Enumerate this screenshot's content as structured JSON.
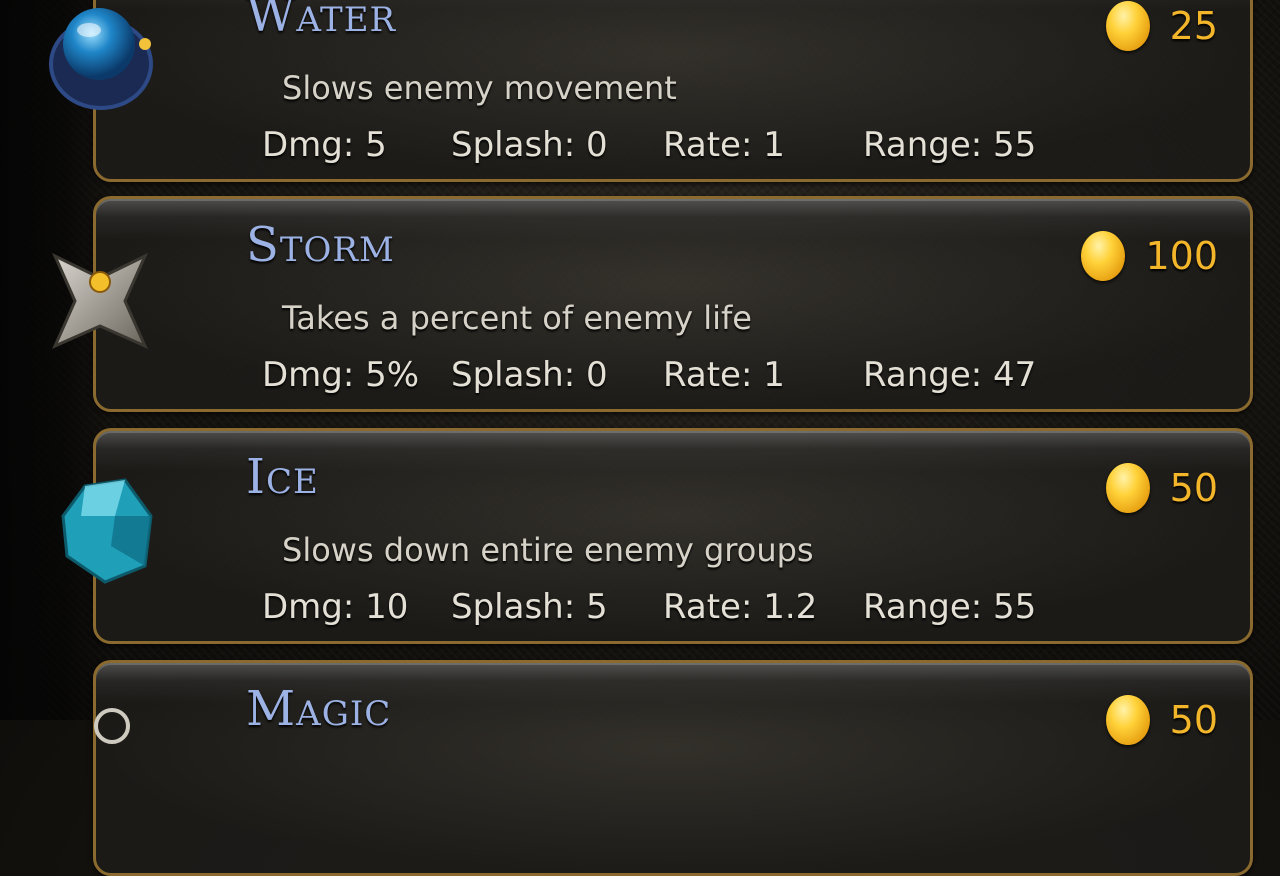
{
  "towers": [
    {
      "name": "Water",
      "description": "Slows enemy movement",
      "dmg": "Dmg: 5",
      "splash": "Splash: 0",
      "rate": "Rate: 1",
      "range": "Range: 55",
      "cost": "25",
      "icon": "water-orb-icon"
    },
    {
      "name": "Storm",
      "description": "Takes a percent of enemy life",
      "dmg": "Dmg: 5%",
      "splash": "Splash: 0",
      "rate": "Rate: 1",
      "range": "Range: 47",
      "cost": "100",
      "icon": "storm-shuriken-icon"
    },
    {
      "name": "Ice",
      "description": "Slows down entire enemy groups",
      "dmg": "Dmg: 10",
      "splash": "Splash: 5",
      "rate": "Rate: 1.2",
      "range": "Range: 55",
      "cost": "50",
      "icon": "ice-crystal-icon"
    },
    {
      "name": "Magic",
      "cost": "50",
      "icon": "magic-icon"
    }
  ],
  "colors": {
    "title": "#9cb2e4",
    "coin": "#f3b52a",
    "border": "#8a6a2e"
  }
}
